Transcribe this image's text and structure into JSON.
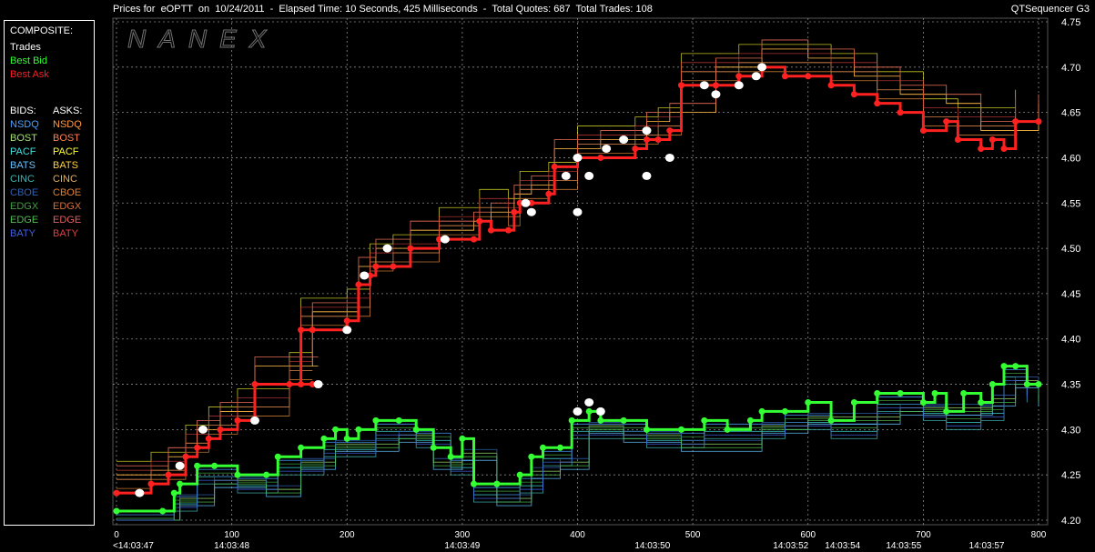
{
  "header": {
    "title": "Prices for  eOPTT  on  10/24/2011  -  Elapsed Time: 10 Seconds, 425 Milliseconds  -  Total Quotes: 687  Total Trades: 108",
    "app": "QTSequencer G3",
    "watermark": "NANEX"
  },
  "legend": {
    "composite_label": "COMPOSITE:",
    "composite": [
      {
        "label": "Trades",
        "color": "#ffffff"
      },
      {
        "label": "Best Bid",
        "color": "#33ff33"
      },
      {
        "label": "Best Ask",
        "color": "#ff2020"
      }
    ],
    "bids_label": "BIDS:",
    "asks_label": "ASKS:",
    "exchanges": [
      {
        "bid": "NSDQ",
        "ask": "NSDQ",
        "bid_color": "#4aa0ff",
        "ask_color": "#ff9a40"
      },
      {
        "bid": "BOST",
        "ask": "BOST",
        "bid_color": "#a0e070",
        "ask_color": "#ff8050"
      },
      {
        "bid": "PACF",
        "ask": "PACF",
        "bid_color": "#40e0e0",
        "ask_color": "#ffff30"
      },
      {
        "bid": "BATS",
        "ask": "BATS",
        "bid_color": "#60c0ff",
        "ask_color": "#ffd040"
      },
      {
        "bid": "CINC",
        "ask": "CINC",
        "bid_color": "#40b0b0",
        "ask_color": "#e0b060"
      },
      {
        "bid": "CBOE",
        "ask": "CBOE",
        "bid_color": "#3060b0",
        "ask_color": "#e08030"
      },
      {
        "bid": "EDGX",
        "ask": "EDGX",
        "bid_color": "#40a040",
        "ask_color": "#d07040"
      },
      {
        "bid": "EDGE",
        "ask": "EDGE",
        "bid_color": "#50c050",
        "ask_color": "#e06060"
      },
      {
        "bid": "BATY",
        "ask": "BATY",
        "bid_color": "#4060e0",
        "ask_color": "#e04040"
      }
    ]
  },
  "chart_data": {
    "type": "line",
    "xlim": [
      0,
      800
    ],
    "ylim": [
      4.2,
      4.75
    ],
    "grid": true,
    "y_ticks": [
      "4.75",
      "4.70",
      "4.65",
      "4.60",
      "4.55",
      "4.50",
      "4.45",
      "4.40",
      "4.35",
      "4.30",
      "4.25",
      "4.20"
    ],
    "x_ticks": [
      {
        "x": 0,
        "label": "0"
      },
      {
        "x": 100,
        "label": "100"
      },
      {
        "x": 200,
        "label": "200"
      },
      {
        "x": 300,
        "label": "300"
      },
      {
        "x": 400,
        "label": "400"
      },
      {
        "x": 500,
        "label": "500"
      },
      {
        "x": 600,
        "label": "600"
      },
      {
        "x": 700,
        "label": "700"
      },
      {
        "x": 800,
        "label": "800"
      }
    ],
    "time_labels": [
      {
        "x": 0,
        "label": "<14:03:47"
      },
      {
        "x": 100,
        "label": "14:03:48"
      },
      {
        "x": 300,
        "label": "14:03:49"
      },
      {
        "x": 465,
        "label": "14:03:50"
      },
      {
        "x": 585,
        "label": "14:03:52"
      },
      {
        "x": 630,
        "label": "14:03:54"
      },
      {
        "x": 683,
        "label": "14:03:55"
      },
      {
        "x": 755,
        "label": "14:03:57"
      }
    ],
    "series": [
      {
        "name": "Best Ask",
        "color": "#ff2020",
        "points": [
          [
            0,
            4.23
          ],
          [
            20,
            4.23
          ],
          [
            30,
            4.24
          ],
          [
            45,
            4.25
          ],
          [
            60,
            4.27
          ],
          [
            70,
            4.28
          ],
          [
            80,
            4.29
          ],
          [
            90,
            4.3
          ],
          [
            105,
            4.31
          ],
          [
            120,
            4.35
          ],
          [
            150,
            4.35
          ],
          [
            160,
            4.35
          ],
          [
            170,
            4.35
          ],
          [
            175,
            4.35
          ],
          [
            160,
            4.41
          ],
          [
            170,
            4.41
          ],
          [
            200,
            4.42
          ],
          [
            210,
            4.46
          ],
          [
            220,
            4.47
          ],
          [
            225,
            4.48
          ],
          [
            240,
            4.48
          ],
          [
            255,
            4.5
          ],
          [
            280,
            4.51
          ],
          [
            310,
            4.51
          ],
          [
            315,
            4.53
          ],
          [
            325,
            4.52
          ],
          [
            340,
            4.52
          ],
          [
            345,
            4.54
          ],
          [
            350,
            4.55
          ],
          [
            360,
            4.55
          ],
          [
            375,
            4.56
          ],
          [
            380,
            4.59
          ],
          [
            400,
            4.6
          ],
          [
            420,
            4.6
          ],
          [
            450,
            4.61
          ],
          [
            460,
            4.62
          ],
          [
            470,
            4.62
          ],
          [
            480,
            4.63
          ],
          [
            490,
            4.68
          ],
          [
            520,
            4.68
          ],
          [
            540,
            4.69
          ],
          [
            560,
            4.7
          ],
          [
            580,
            4.69
          ],
          [
            600,
            4.69
          ],
          [
            620,
            4.68
          ],
          [
            640,
            4.67
          ],
          [
            660,
            4.66
          ],
          [
            680,
            4.65
          ],
          [
            700,
            4.63
          ],
          [
            720,
            4.64
          ],
          [
            730,
            4.62
          ],
          [
            750,
            4.61
          ],
          [
            760,
            4.62
          ],
          [
            770,
            4.61
          ],
          [
            780,
            4.64
          ],
          [
            800,
            4.64
          ]
        ]
      },
      {
        "name": "Best Bid",
        "color": "#33ff33",
        "points": [
          [
            0,
            4.21
          ],
          [
            40,
            4.21
          ],
          [
            50,
            4.23
          ],
          [
            55,
            4.24
          ],
          [
            70,
            4.26
          ],
          [
            85,
            4.26
          ],
          [
            105,
            4.25
          ],
          [
            130,
            4.25
          ],
          [
            140,
            4.27
          ],
          [
            160,
            4.28
          ],
          [
            180,
            4.29
          ],
          [
            190,
            4.3
          ],
          [
            200,
            4.29
          ],
          [
            210,
            4.3
          ],
          [
            225,
            4.31
          ],
          [
            245,
            4.31
          ],
          [
            260,
            4.3
          ],
          [
            275,
            4.28
          ],
          [
            290,
            4.27
          ],
          [
            300,
            4.29
          ],
          [
            310,
            4.24
          ],
          [
            330,
            4.24
          ],
          [
            350,
            4.25
          ],
          [
            360,
            4.27
          ],
          [
            370,
            4.28
          ],
          [
            385,
            4.28
          ],
          [
            395,
            4.31
          ],
          [
            410,
            4.32
          ],
          [
            420,
            4.31
          ],
          [
            440,
            4.31
          ],
          [
            460,
            4.3
          ],
          [
            490,
            4.3
          ],
          [
            510,
            4.31
          ],
          [
            530,
            4.3
          ],
          [
            550,
            4.31
          ],
          [
            560,
            4.32
          ],
          [
            580,
            4.32
          ],
          [
            600,
            4.33
          ],
          [
            620,
            4.31
          ],
          [
            640,
            4.33
          ],
          [
            660,
            4.34
          ],
          [
            680,
            4.34
          ],
          [
            700,
            4.33
          ],
          [
            710,
            4.34
          ],
          [
            720,
            4.32
          ],
          [
            735,
            4.34
          ],
          [
            750,
            4.33
          ],
          [
            760,
            4.35
          ],
          [
            770,
            4.37
          ],
          [
            780,
            4.37
          ],
          [
            790,
            4.35
          ],
          [
            800,
            4.35
          ]
        ]
      },
      {
        "name": "Trades",
        "color": "#ffffff",
        "points": [
          [
            20,
            4.23
          ],
          [
            55,
            4.26
          ],
          [
            75,
            4.3
          ],
          [
            120,
            4.31
          ],
          [
            175,
            4.35
          ],
          [
            200,
            4.41
          ],
          [
            215,
            4.47
          ],
          [
            235,
            4.5
          ],
          [
            285,
            4.51
          ],
          [
            355,
            4.55
          ],
          [
            360,
            4.54
          ],
          [
            390,
            4.58
          ],
          [
            400,
            4.32
          ],
          [
            410,
            4.33
          ],
          [
            420,
            4.32
          ],
          [
            400,
            4.6
          ],
          [
            410,
            4.58
          ],
          [
            425,
            4.61
          ],
          [
            440,
            4.62
          ],
          [
            460,
            4.63
          ],
          [
            480,
            4.6
          ],
          [
            510,
            4.68
          ],
          [
            520,
            4.67
          ],
          [
            540,
            4.68
          ],
          [
            555,
            4.69
          ],
          [
            560,
            4.7
          ],
          [
            400,
            4.54
          ],
          [
            460,
            4.58
          ]
        ]
      }
    ]
  }
}
